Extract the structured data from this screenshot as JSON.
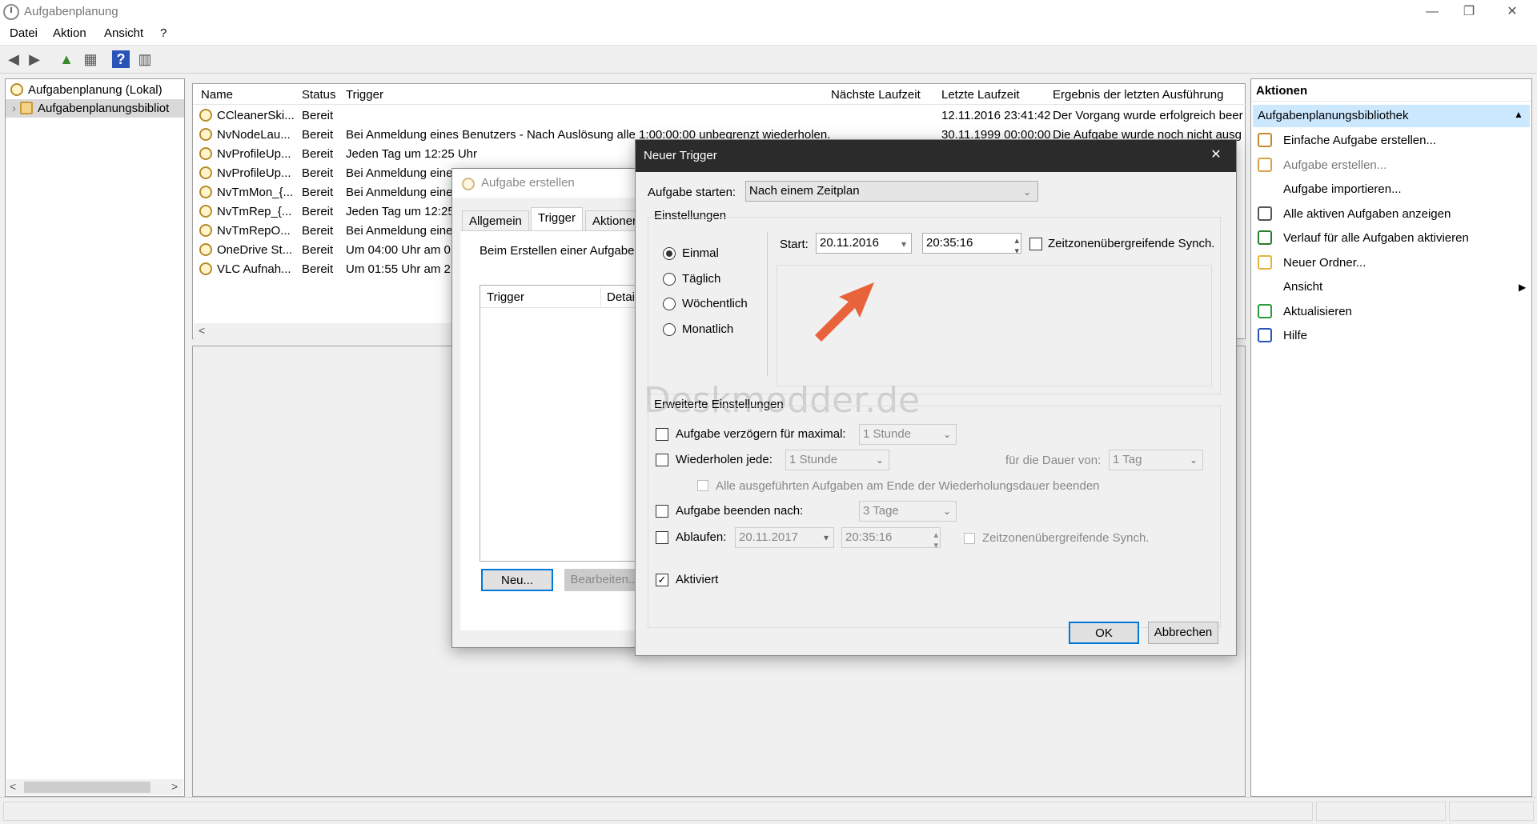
{
  "window": {
    "title": "Aufgabenplanung",
    "minimize": "—",
    "restore": "❐",
    "close": "✕"
  },
  "menu": [
    "Datei",
    "Aktion",
    "Ansicht",
    "?"
  ],
  "toolbar": {
    "back": "◀",
    "forward": "▶",
    "up": "▲",
    "view": "▦",
    "help": "?",
    "pane": "▥"
  },
  "tree": {
    "root": "Aufgabenplanung (Lokal)",
    "child": "Aufgabenplanungsbibliot",
    "expander": "›",
    "scroll_left": "<",
    "scroll_right": ">"
  },
  "columns": [
    "Name",
    "Status",
    "Trigger",
    "Nächste Laufzeit",
    "Letzte Laufzeit",
    "Ergebnis der letzten Ausführung"
  ],
  "tasks": [
    {
      "name": "CCleanerSki...",
      "status": "Bereit",
      "trigger": "",
      "last": "12.11.2016 23:41:42",
      "result": "Der Vorgang wurde erfolgreich beer"
    },
    {
      "name": "NvNodeLau...",
      "status": "Bereit",
      "trigger": "Bei Anmeldung eines Benutzers - Nach Auslösung alle 1:00:00:00 unbegrenzt wiederholen.",
      "last": "30.11.1999 00:00:00",
      "result": "Die Aufgabe wurde noch nicht ausg"
    },
    {
      "name": "NvProfileUp...",
      "status": "Bereit",
      "trigger": "Jeden Tag um 12:25 Uhr",
      "last": "",
      "result": ""
    },
    {
      "name": "NvProfileUp...",
      "status": "Bereit",
      "trigger": "Bei Anmeldung eine",
      "last": "",
      "result": ""
    },
    {
      "name": "NvTmMon_{...",
      "status": "Bereit",
      "trigger": "Bei Anmeldung eine",
      "last": "",
      "result": ""
    },
    {
      "name": "NvTmRep_{...",
      "status": "Bereit",
      "trigger": "Jeden Tag um 12:25",
      "last": "",
      "result": ""
    },
    {
      "name": "NvTmRepO...",
      "status": "Bereit",
      "trigger": "Bei Anmeldung eine",
      "last": "",
      "result": ""
    },
    {
      "name": "OneDrive St...",
      "status": "Bereit",
      "trigger": "Um 04:00 Uhr am 01.",
      "last": "",
      "result": ""
    },
    {
      "name": "VLC Aufnah...",
      "status": "Bereit",
      "trigger": "Um 01:55 Uhr am 21.",
      "last": "",
      "result": ""
    }
  ],
  "actions": {
    "header": "Aktionen",
    "section": "Aufgabenplanungsbibliothek",
    "collapse": "▲",
    "submenu": "▶",
    "items": [
      "Einfache Aufgabe erstellen...",
      "Aufgabe erstellen...",
      "Aufgabe importieren...",
      "Alle aktiven Aufgaben anzeigen",
      "Verlauf für alle Aufgaben aktivieren",
      "Neuer Ordner...",
      "Ansicht",
      "Aktualisieren",
      "Hilfe"
    ]
  },
  "dialog_create": {
    "title": "Aufgabe erstellen",
    "tabs": [
      "Allgemein",
      "Trigger",
      "Aktionen"
    ],
    "info": "Beim Erstellen einer Aufgabe",
    "list_cols": [
      "Trigger",
      "Detail"
    ],
    "btn_new": "Neu...",
    "btn_edit": "Bearbeiten..."
  },
  "dialog_trigger": {
    "title": "Neuer Trigger",
    "close": "✕",
    "start_task_label": "Aufgabe starten:",
    "start_task_value": "Nach einem Zeitplan",
    "settings_label": "Einstellungen",
    "radios": [
      "Einmal",
      "Täglich",
      "Wöchentlich",
      "Monatlich"
    ],
    "start_label": "Start:",
    "start_date": "20.11.2016",
    "start_time": "20:35:16",
    "sync_label": "Zeitzonenübergreifende Synch.",
    "advanced_label": "Erweiterte Einstellungen",
    "delay_label": "Aufgabe verzögern für maximal:",
    "delay_value": "1 Stunde",
    "repeat_label": "Wiederholen jede:",
    "repeat_value": "1 Stunde",
    "duration_label": "für die Dauer von:",
    "duration_value": "1 Tag",
    "stop_all_label": "Alle ausgeführten Aufgaben am Ende der Wiederholungsdauer beenden",
    "stop_after_label": "Aufgabe beenden nach:",
    "stop_after_value": "3 Tage",
    "expire_label": "Ablaufen:",
    "expire_date": "20.11.2017",
    "expire_time": "20:35:16",
    "expire_sync_label": "Zeitzonenübergreifende Synch.",
    "enabled_label": "Aktiviert",
    "ok": "OK",
    "cancel": "Abbrechen",
    "check_mark": "✓",
    "dropdown_arrow": "⌄",
    "calendar_arrow": "▾",
    "spin_up": "▴",
    "spin_down": "▾"
  },
  "watermark": "Deskmodder.de",
  "colors": {
    "accent_arrow": "#e8623a",
    "selection": "#cce8ff",
    "titlebar_dark": "#2b2b2b",
    "default_button_border": "#0078d7"
  }
}
